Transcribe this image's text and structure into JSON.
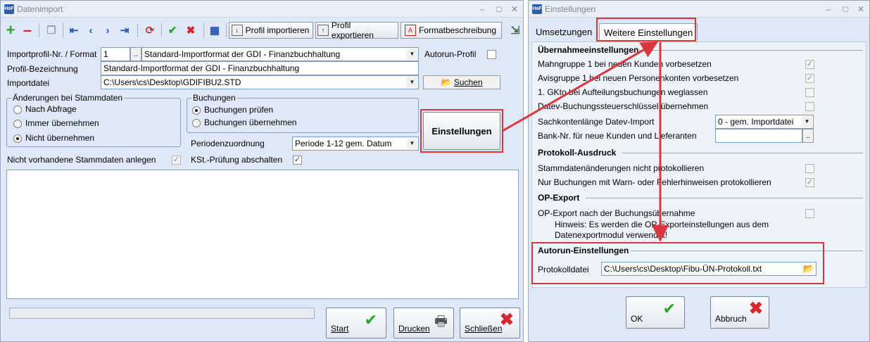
{
  "import_window": {
    "title": "Datenimport",
    "logo_text": "HaF",
    "controls": [
      "–",
      "□",
      "✕"
    ],
    "toolbar": {
      "profil_importieren": "Profil importieren",
      "profil_exportieren": "Profil exportieren",
      "formatbeschreibung": "Formatbeschreibung"
    },
    "form": {
      "importprofil_label": "Importprofil-Nr. / Format",
      "importprofil_nr": "1",
      "browse_label": "..",
      "format_value": "Standard-Importformat der GDI - Finanzbuchhaltung",
      "autorun_label": "Autorun-Profil",
      "autorun_checked": false,
      "bezeichnung_label": "Profil-Bezeichnung",
      "bezeichnung_value": "Standard-Importformat der GDI - Finanzbuchhaltung",
      "importdatei_label": "Importdatei",
      "importdatei_value": "C:\\Users\\cs\\Desktop\\GDIFIBU2.STD",
      "suchen_label": "Suchen"
    },
    "stammdaten_group": {
      "title": "Änderungen bei Stammdaten",
      "options": [
        "Nach Abfrage",
        "Immer übernehmen",
        "Nicht übernehmen"
      ],
      "selected": 2
    },
    "buchungen_group": {
      "title": "Buchungen",
      "options": [
        "Buchungen prüfen",
        "Buchungen übernehmen"
      ],
      "selected": 0
    },
    "einstellungen_button": "Einstellungen",
    "periodenzuordnung_label": "Periodenzuordnung",
    "periodenzuordnung_value": "Periode 1-12 gem. Datum",
    "nicht_vorhandene_label": "Nicht vorhandene Stammdaten anlegen",
    "nicht_vorhandene_checked": true,
    "kst_label": "KSt.-Prüfung abschalten",
    "kst_checked": true,
    "progress": 0,
    "buttons": {
      "start": "Start",
      "drucken": "Drucken",
      "schliessen": "Schließen"
    }
  },
  "settings_window": {
    "title": "Einstellungen",
    "logo_text": "HaF",
    "controls": [
      "–",
      "□",
      "✕"
    ],
    "tabs": [
      "Umsetzungen",
      "Weitere Einstellungen"
    ],
    "active_tab": 1,
    "sections": {
      "uebernahme": {
        "title": "Übernahmeeinstellungen",
        "items": [
          {
            "label": "Mahngruppe 1 bei neuen Kunden vorbesetzen",
            "checked": true
          },
          {
            "label": "Avisgruppe 1 bei neuen Personenkonten vorbesetzen",
            "checked": true
          },
          {
            "label": "1. GKto bei Aufteilungsbuchungen weglassen",
            "checked": false
          },
          {
            "label": "Datev-Buchungssteuerschlüssel übernehmen",
            "checked": false
          }
        ],
        "sachkonten_label": "Sachkontenlänge Datev-Import",
        "sachkonten_value": "0 - gem. Importdatei",
        "bank_label": "Bank-Nr. für neue Kunden und Lieferanten",
        "bank_value": "",
        "bank_browse": ".."
      },
      "protokoll": {
        "title": "Protokoll-Ausdruck",
        "items": [
          {
            "label": "Stammdatenänderungen nicht protokollieren",
            "checked": false
          },
          {
            "label": "Nur Buchungen mit Warn- oder Fehlerhinweisen protokollieren",
            "checked": true
          }
        ]
      },
      "op_export": {
        "title": "OP-Export",
        "item_label": "OP-Export nach der Buchungsübernahme",
        "item_checked": false,
        "hint_line1": "Hinweis: Es werden die OP-Exporteinstellungen aus dem",
        "hint_line2": "Datenexportmodul verwendet!"
      },
      "autorun": {
        "title": "Autorun-Einstellungen",
        "protokolldatei_label": "Protokolldatei",
        "protokolldatei_value": "C:\\Users\\cs\\Desktop\\Fibu-ÜN-Protokoll.txt"
      }
    },
    "buttons": {
      "ok": "OK",
      "abbruch": "Abbruch"
    }
  },
  "colors": {
    "annotation": "#d9363e",
    "window_bg": "#dfe8f6",
    "accent_green": "#2aa52a",
    "accent_red": "#d8262e",
    "toolbar_blue": "#2456b0"
  }
}
